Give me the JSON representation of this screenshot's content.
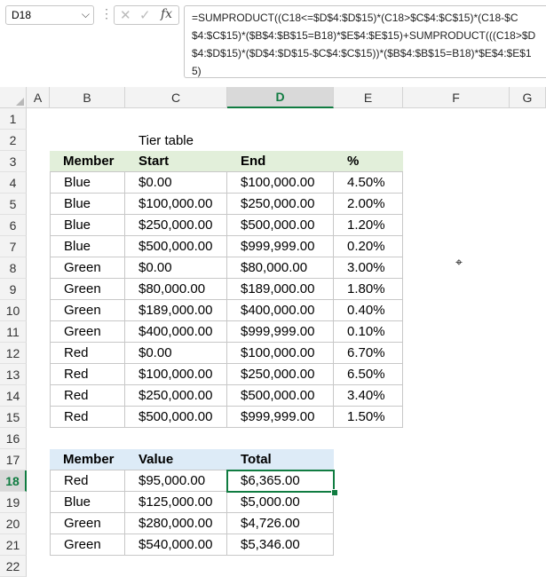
{
  "formula_bar": {
    "name_box": "D18",
    "formula": "=SUMPRODUCT((C18<=$D$4:$D$15)*(C18>$C$4:$C$15)*(C18-$C$4:$C$15)*($B$4:$B$15=B18)*$E$4:$E$15)+SUMPRODUCT(((C18>$D$4:$D$15)*($D$4:$D$15-$C$4:$C$15))*($B$4:$B$15=B18)*$E$4:$E$15)",
    "cancel_glyph": "✕",
    "enter_glyph": "✓",
    "fx_glyph": "fx",
    "more_glyph": "⋮",
    "dropdown_glyph": "⌵"
  },
  "columns": [
    "A",
    "B",
    "C",
    "D",
    "E",
    "F",
    "G"
  ],
  "rows": [
    "1",
    "2",
    "3",
    "4",
    "5",
    "6",
    "7",
    "8",
    "9",
    "10",
    "11",
    "12",
    "13",
    "14",
    "15",
    "16",
    "17",
    "18",
    "19",
    "20",
    "21",
    "22"
  ],
  "selection": {
    "cell": "D18",
    "column": "D",
    "row": "18"
  },
  "tier_table": {
    "title": "Tier table",
    "headers": [
      "Member",
      "Start",
      "End",
      "%"
    ],
    "rows": [
      [
        "Blue",
        "$0.00",
        "$100,000.00",
        "4.50%"
      ],
      [
        "Blue",
        "$100,000.00",
        "$250,000.00",
        "2.00%"
      ],
      [
        "Blue",
        "$250,000.00",
        "$500,000.00",
        "1.20%"
      ],
      [
        "Blue",
        "$500,000.00",
        "$999,999.00",
        "0.20%"
      ],
      [
        "Green",
        "$0.00",
        "$80,000.00",
        "3.00%"
      ],
      [
        "Green",
        "$80,000.00",
        "$189,000.00",
        "1.80%"
      ],
      [
        "Green",
        "$189,000.00",
        "$400,000.00",
        "0.40%"
      ],
      [
        "Green",
        "$400,000.00",
        "$999,999.00",
        "0.10%"
      ],
      [
        "Red",
        "$0.00",
        "$100,000.00",
        "6.70%"
      ],
      [
        "Red",
        "$100,000.00",
        "$250,000.00",
        "6.50%"
      ],
      [
        "Red",
        "$250,000.00",
        "$500,000.00",
        "3.40%"
      ],
      [
        "Red",
        "$500,000.00",
        "$999,999.00",
        "1.50%"
      ]
    ]
  },
  "result_table": {
    "headers": [
      "Member",
      "Value",
      "Total"
    ],
    "rows": [
      [
        "Red",
        "$95,000.00",
        "$6,365.00"
      ],
      [
        "Blue",
        "$125,000.00",
        "$5,000.00"
      ],
      [
        "Green",
        "$280,000.00",
        "$4,726.00"
      ],
      [
        "Green",
        "$540,000.00",
        "$5,346.00"
      ]
    ]
  },
  "colors": {
    "tier_header_fill": "#e2efda",
    "result_header_fill": "#ddebf7",
    "selection_accent": "#107c41"
  },
  "cursor_glyph": "⌖"
}
